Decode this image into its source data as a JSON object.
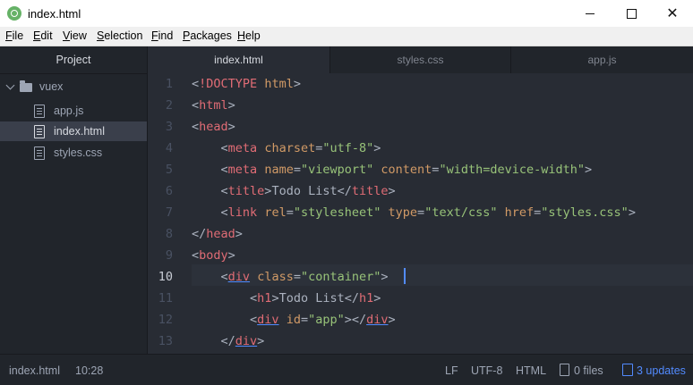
{
  "window": {
    "title": "index.html",
    "icon": "atom-app-icon"
  },
  "menu": [
    "File",
    "Edit",
    "View",
    "Selection",
    "Find",
    "Packages",
    "Help"
  ],
  "sidebar": {
    "header": "Project",
    "folder": "vuex",
    "files": [
      {
        "label": "app.js",
        "active": false
      },
      {
        "label": "index.html",
        "active": true
      },
      {
        "label": "styles.css",
        "active": false
      }
    ]
  },
  "tabs": [
    {
      "label": "index.html",
      "active": true
    },
    {
      "label": "styles.css",
      "active": false
    },
    {
      "label": "app.js",
      "active": false
    }
  ],
  "editor": {
    "current_line": 10,
    "lines": [
      {
        "n": "1",
        "text": "<!DOCTYPE html>"
      },
      {
        "n": "2",
        "text": "<html>"
      },
      {
        "n": "3",
        "text": "<head>"
      },
      {
        "n": "4",
        "text": "    <meta charset=\"utf-8\">"
      },
      {
        "n": "5",
        "text": "    <meta name=\"viewport\" content=\"width=device-width\">"
      },
      {
        "n": "6",
        "text": "    <title>Todo List</title>"
      },
      {
        "n": "7",
        "text": "    <link rel=\"stylesheet\" type=\"text/css\" href=\"styles.css\">"
      },
      {
        "n": "8",
        "text": "</head>"
      },
      {
        "n": "9",
        "text": "<body>"
      },
      {
        "n": "10",
        "text": "    <div class=\"container\">"
      },
      {
        "n": "11",
        "text": "        <h1>Todo List</h1>"
      },
      {
        "n": "12",
        "text": "        <div id=\"app\"></div>"
      },
      {
        "n": "13",
        "text": "    </div>"
      }
    ]
  },
  "status": {
    "file": "index.html",
    "cursor": "10:28",
    "line_ending": "LF",
    "encoding": "UTF-8",
    "grammar": "HTML",
    "files": "0 files",
    "updates": "3 updates"
  },
  "colors": {
    "tag": "#e06c75",
    "attribute": "#d19a66",
    "string": "#98c379",
    "text": "#abb2bf",
    "accent": "#528bff"
  }
}
